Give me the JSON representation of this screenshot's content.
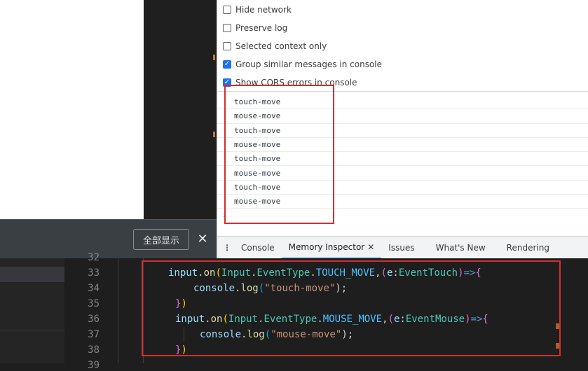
{
  "download_bar": {
    "show_all_label": "全部显示",
    "close_glyph": "✕"
  },
  "settings": [
    {
      "label": "Hide network",
      "checked": false
    },
    {
      "label": "Preserve log",
      "checked": false
    },
    {
      "label": "Selected context only",
      "checked": false
    },
    {
      "label": "Group similar messages in console",
      "checked": true
    },
    {
      "label": "Show CORS errors in console",
      "checked": true
    }
  ],
  "console_logs": [
    "touch-move",
    "mouse-move",
    "touch-move",
    "mouse-move",
    "touch-move",
    "mouse-move",
    "touch-move",
    "mouse-move"
  ],
  "prompt_glyph": "›",
  "drawer": {
    "menu_glyph": "⋮",
    "tabs": [
      {
        "label": "Console",
        "active": false,
        "closable": false
      },
      {
        "label": "Memory Inspector",
        "active": true,
        "closable": true
      },
      {
        "label": "Issues",
        "active": false,
        "closable": false
      },
      {
        "label": "What's New",
        "active": false,
        "closable": false
      },
      {
        "label": "Rendering",
        "active": false,
        "closable": false
      }
    ],
    "tab_close_glyph": "✕"
  },
  "editor": {
    "line_numbers": [
      "32",
      "33",
      "34",
      "35",
      "36",
      "37",
      "38",
      "39"
    ],
    "lines": {
      "l33": {
        "obj": "input",
        "dot": ".",
        "method": "on",
        "open": "(",
        "cls": "Input",
        "dot2": ".",
        "enum": "EventType",
        "dot3": ".",
        "member": "TOUCH_MOVE",
        "comma": ",",
        "open2": "(",
        "param": "e",
        "colon": ":",
        "type": "EventTouch",
        "close2": ")",
        "arrow": "=>",
        "brace": "{"
      },
      "l34": {
        "obj": "console",
        "dot": ".",
        "method": "log",
        "open": "(",
        "str": "\"touch-move\"",
        "close": ");"
      },
      "l35": {
        "brace": "}",
        "paren": ")"
      },
      "l36": {
        "obj": "input",
        "dot": ".",
        "method": "on",
        "open": "(",
        "cls": "Input",
        "dot2": ".",
        "enum": "EventType",
        "dot3": ".",
        "member": "MOUSE_MOVE",
        "comma": ",",
        "open2": "(",
        "param": "e",
        "colon": ":",
        "type": "EventMouse",
        "close2": ")",
        "arrow": "=>",
        "brace": "{"
      },
      "l37": {
        "obj": "console",
        "dot": ".",
        "method": "log",
        "open": "(",
        "str": "\"mouse-move\"",
        "close": ");"
      },
      "l38": {
        "brace": "}",
        "paren": ")"
      }
    }
  }
}
